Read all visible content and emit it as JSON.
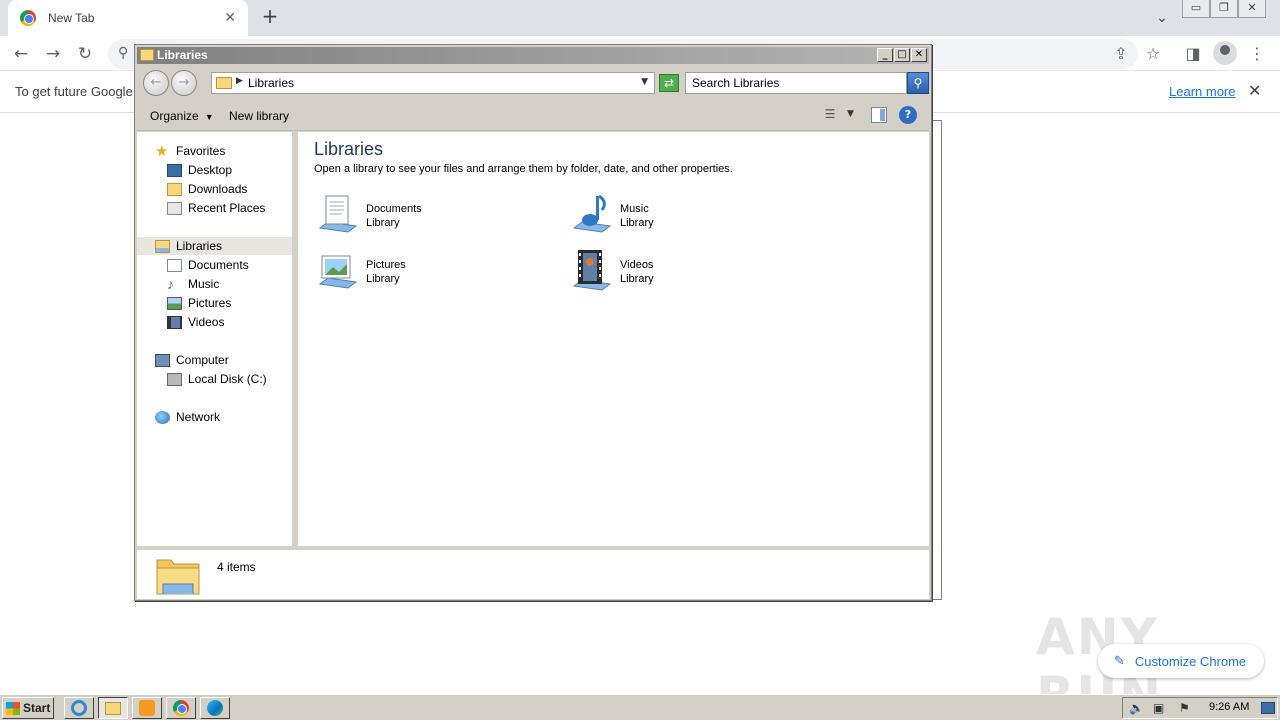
{
  "browser": {
    "tab_title": "New Tab",
    "infobar_text": "To get future Google",
    "learn_more": "Learn more",
    "customize_label": "Customize Chrome",
    "watermark": "ANY RUN"
  },
  "explorer": {
    "title": "Libraries",
    "address": "Libraries",
    "search_placeholder": "Search Libraries",
    "commands": {
      "organize": "Organize",
      "new_library": "New library"
    },
    "nav": {
      "favorites": "Favorites",
      "desktop": "Desktop",
      "downloads": "Downloads",
      "recent_places": "Recent Places",
      "libraries": "Libraries",
      "documents": "Documents",
      "music": "Music",
      "pictures": "Pictures",
      "videos": "Videos",
      "computer": "Computer",
      "local_disk": "Local Disk (C:)",
      "network": "Network"
    },
    "content": {
      "heading": "Libraries",
      "description": "Open a library to see your files and arrange them by folder, date, and other properties.",
      "libraries": [
        {
          "name": "Documents",
          "type": "Library",
          "icon": "documents-library-icon"
        },
        {
          "name": "Music",
          "type": "Library",
          "icon": "music-library-icon"
        },
        {
          "name": "Pictures",
          "type": "Library",
          "icon": "pictures-library-icon"
        },
        {
          "name": "Videos",
          "type": "Library",
          "icon": "videos-library-icon"
        }
      ]
    },
    "details": "4 items"
  },
  "taskbar": {
    "start_label": "Start",
    "clock": "9:26 AM"
  }
}
